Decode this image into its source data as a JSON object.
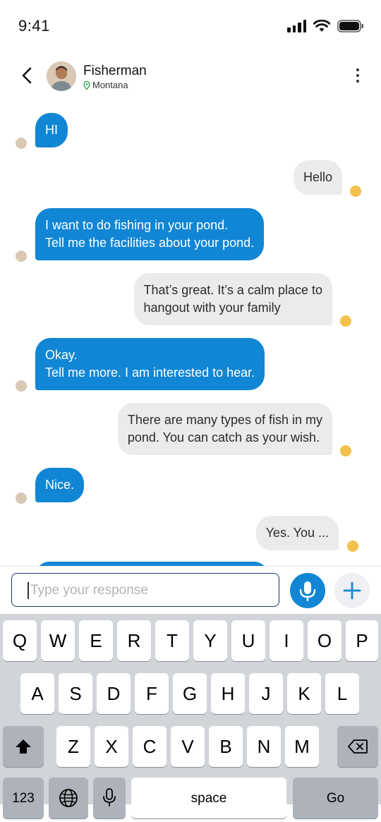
{
  "status": {
    "time": "9:41"
  },
  "header": {
    "name": "Fisherman",
    "location": "Montana"
  },
  "messages": [
    {
      "dir": "in",
      "lines": [
        "HI"
      ]
    },
    {
      "dir": "out",
      "lines": [
        "Hello"
      ]
    },
    {
      "dir": "in",
      "lines": [
        "I want to do fishing in your pond.",
        "Tell me the facilities about your pond."
      ]
    },
    {
      "dir": "out",
      "lines": [
        "That’s great. It’s a calm place to",
        "hangout with your family"
      ]
    },
    {
      "dir": "in",
      "lines": [
        "Okay.",
        "Tell me more. I am interested to hear."
      ]
    },
    {
      "dir": "out",
      "lines": [
        "There are many types of fish in my",
        "pond. You can catch as your wish."
      ]
    },
    {
      "dir": "in",
      "lines": [
        "Nice."
      ]
    },
    {
      "dir": "out",
      "lines": [
        "Yes. You ..."
      ]
    }
  ],
  "composer": {
    "placeholder": "Type your response"
  },
  "keyboard": {
    "row1": [
      "Q",
      "W",
      "E",
      "R",
      "T",
      "Y",
      "U",
      "I",
      "O",
      "P"
    ],
    "row2": [
      "A",
      "S",
      "D",
      "F",
      "G",
      "H",
      "J",
      "K",
      "L"
    ],
    "row3": [
      "Z",
      "X",
      "C",
      "V",
      "B",
      "N",
      "M"
    ],
    "numbers_label": "123",
    "space_label": "space",
    "go_label": "Go"
  },
  "colors": {
    "accent": "#1186d4",
    "incoming_bubble": "#1186d4",
    "outgoing_bubble": "#ebebeb"
  }
}
